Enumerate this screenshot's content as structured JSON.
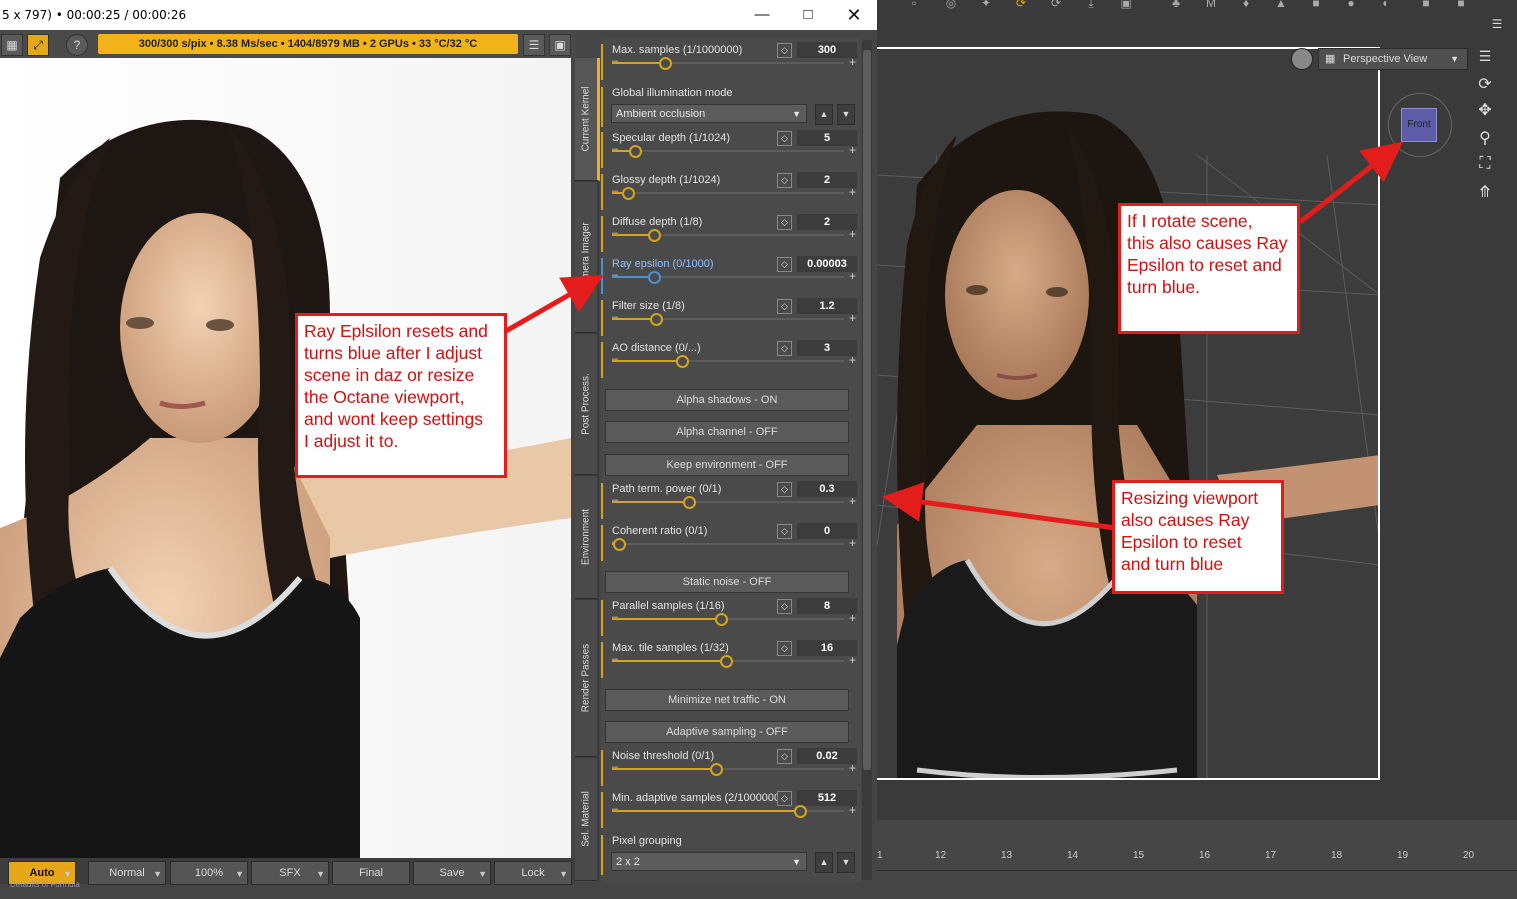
{
  "octane_window": {
    "title": "5 x 797) • 00:00:25 / 00:00:26",
    "status": "300/300 s/pix • 8.38 Ms/sec • 1404/8979 MB • 2 GPUs • 33 °C/32 °C",
    "help_glyph": "?",
    "bottom_buttons": [
      "Auto",
      "Normal",
      "100%",
      "SFX",
      "Final",
      "Save",
      "Lock"
    ],
    "footer_text": "Defaults of Formula"
  },
  "side_tabs": [
    "Current Kernel",
    "Camera Imager",
    "Post Process.",
    "Environment",
    "Render Passes",
    "Sel. Material"
  ],
  "kernel_params": [
    {
      "label": "Max. samples (1/1000000)",
      "value": "300",
      "fraction": 0.23
    },
    {
      "label": "Specular depth (1/1024)",
      "value": "5",
      "fraction": 0.1
    },
    {
      "label": "Glossy depth (1/1024)",
      "value": "2",
      "fraction": 0.07
    },
    {
      "label": "Diffuse depth (1/8)",
      "value": "2",
      "fraction": 0.18
    },
    {
      "label": "Ray epsilon (0/1000)",
      "value": "0.00003",
      "fraction": 0.18,
      "highlight": true
    },
    {
      "label": "Filter size (1/8)",
      "value": "1.2",
      "fraction": 0.19
    },
    {
      "label": "AO distance (0/...)",
      "value": "3",
      "fraction": 0.3
    },
    {
      "label": "Path term. power (0/1)",
      "value": "0.3",
      "fraction": 0.33
    },
    {
      "label": "Coherent ratio (0/1)",
      "value": "0",
      "fraction": 0.03
    },
    {
      "label": "Parallel samples (1/16)",
      "value": "8",
      "fraction": 0.47
    },
    {
      "label": "Max. tile samples (1/32)",
      "value": "16",
      "fraction": 0.49
    },
    {
      "label": "Noise threshold (0/1)",
      "value": "0.02",
      "fraction": 0.45
    },
    {
      "label": "Min. adaptive samples (2/1000000",
      "value": "512",
      "fraction": 0.81
    }
  ],
  "gi_mode": {
    "label": "Global illumination mode",
    "value": "Ambient occlusion"
  },
  "pixel_grouping": {
    "label": "Pixel grouping",
    "value": "2 x 2"
  },
  "toggles": {
    "alpha_shadows": "Alpha shadows - ON",
    "alpha_channel": "Alpha channel - OFF",
    "keep_environment": "Keep environment - OFF",
    "static_noise": "Static noise - OFF",
    "minimize_net": "Minimize net traffic - ON",
    "adaptive_sampling": "Adaptive sampling - OFF"
  },
  "daz": {
    "view_select": "Perspective View",
    "cube_face": "Front",
    "timeline_ticks": [
      "1",
      "12",
      "13",
      "14",
      "15",
      "16",
      "17",
      "18",
      "19",
      "20"
    ]
  },
  "callouts": {
    "left": [
      "Ray Eplsilon resets and",
      "turns blue after I adjust",
      "scene in daz or resize",
      "the Octane viewport,",
      "and wont keep settings",
      "I adjust it to."
    ],
    "top_right": [
      "If I rotate scene,",
      "this also causes Ray",
      "Epsilon to reset and",
      "turn blue."
    ],
    "bottom_right": [
      "Resizing viewport",
      "also causes Ray",
      "Epsilon to reset",
      "and turn blue"
    ]
  },
  "colors": {
    "accent": "#f2b21a",
    "highlight": "#4b8fd4",
    "callout": "#e31c1c"
  }
}
